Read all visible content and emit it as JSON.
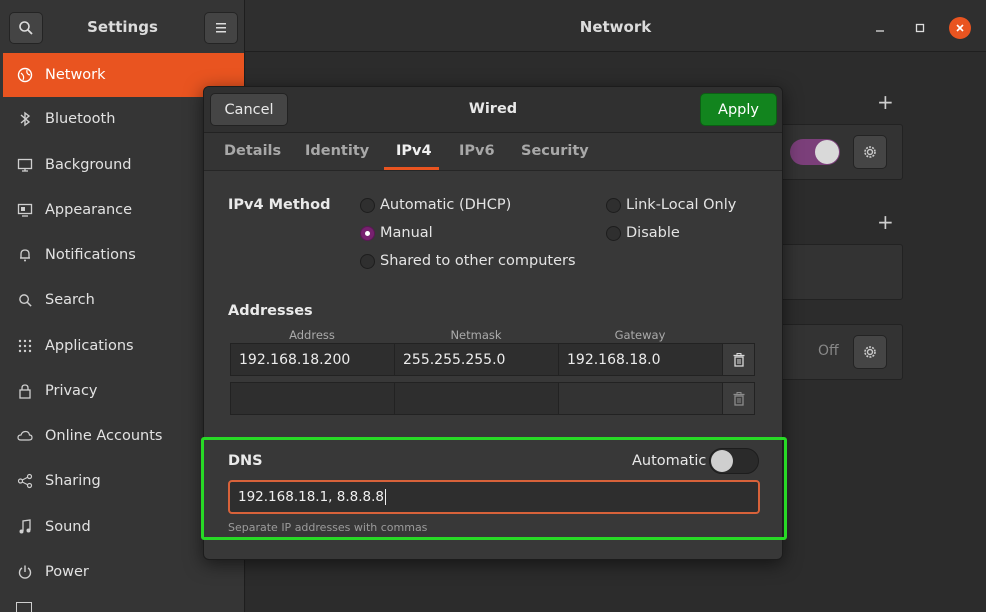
{
  "header": {
    "left_title": "Settings",
    "main_title": "Network",
    "search_icon": "search-icon",
    "menu_icon": "hamburger-icon"
  },
  "sidebar": {
    "items": [
      {
        "label": "Network",
        "icon": "network-icon",
        "active": true
      },
      {
        "label": "Bluetooth",
        "icon": "bluetooth-icon"
      },
      {
        "label": "Background",
        "icon": "background-icon"
      },
      {
        "label": "Appearance",
        "icon": "appearance-icon"
      },
      {
        "label": "Notifications",
        "icon": "bell-icon"
      },
      {
        "label": "Search",
        "icon": "search-icon"
      },
      {
        "label": "Applications",
        "icon": "grid-icon"
      },
      {
        "label": "Privacy",
        "icon": "lock-icon"
      },
      {
        "label": "Online Accounts",
        "icon": "cloud-icon"
      },
      {
        "label": "Sharing",
        "icon": "share-icon"
      },
      {
        "label": "Sound",
        "icon": "music-note-icon"
      },
      {
        "label": "Power",
        "icon": "power-icon"
      }
    ]
  },
  "background": {
    "off_label": "Off"
  },
  "dialog": {
    "title": "Wired",
    "cancel_label": "Cancel",
    "apply_label": "Apply",
    "tabs": [
      {
        "label": "Details"
      },
      {
        "label": "Identity"
      },
      {
        "label": "IPv4",
        "active": true
      },
      {
        "label": "IPv6"
      },
      {
        "label": "Security"
      }
    ],
    "ipv4_method": {
      "label": "IPv4 Method",
      "options": {
        "dhcp": "Automatic (DHCP)",
        "manual": "Manual",
        "shared": "Shared to other computers",
        "link_local": "Link-Local Only",
        "disable": "Disable"
      },
      "selected": "Manual"
    },
    "addresses": {
      "label": "Addresses",
      "columns": [
        "Address",
        "Netmask",
        "Gateway"
      ],
      "rows": [
        {
          "address": "192.168.18.200",
          "netmask": "255.255.255.0",
          "gateway": "192.168.18.0"
        },
        {
          "address": "",
          "netmask": "",
          "gateway": ""
        }
      ]
    },
    "dns": {
      "label": "DNS",
      "automatic_label": "Automatic",
      "automatic_on": false,
      "value": "192.168.18.1, 8.8.8.8",
      "hint": "Separate IP addresses with commas"
    }
  },
  "colors": {
    "accent": "#e95420",
    "apply": "#12841e",
    "highlight": "#28d926",
    "radio_on": "#77216f"
  }
}
